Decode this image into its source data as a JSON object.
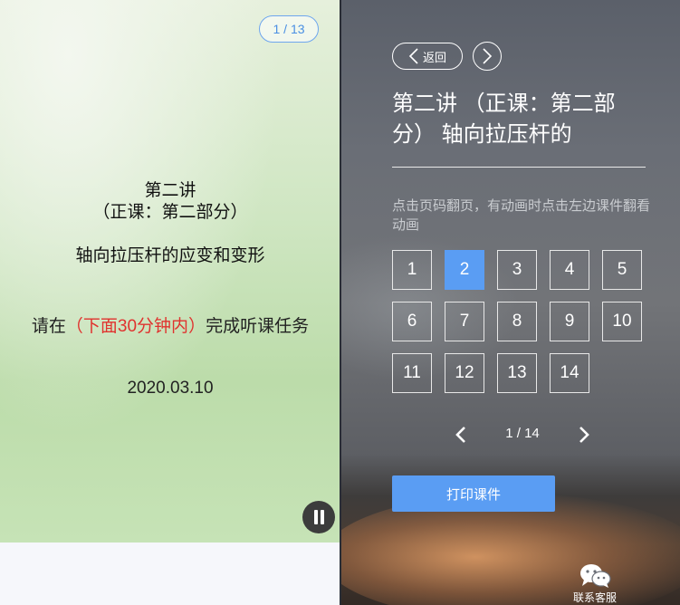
{
  "slide": {
    "page_indicator": "1 / 13",
    "title_line1": "第二讲",
    "title_line2": "（正课：第二部分）",
    "title_line3": "轴向拉压杆的应变和变形",
    "notice_prefix": "请在",
    "notice_highlight": "（下面30分钟内）",
    "notice_suffix": "完成听课任务",
    "date": "2020.03.10",
    "pause_icon": "pause-icon"
  },
  "panel": {
    "back_label": "返回",
    "lesson_title": "第二讲 （正课：第二部分） 轴向拉压杆的",
    "hint": "点击页码翻页，有动画时点击左边课件翻看动画",
    "pages": [
      "1",
      "2",
      "3",
      "4",
      "5",
      "6",
      "7",
      "8",
      "9",
      "10",
      "11",
      "12",
      "13",
      "14"
    ],
    "active_page": "2",
    "pager_label": "1 / 14",
    "print_label": "打印课件",
    "support_label": "联系客服",
    "accent": "#5a9df3"
  }
}
